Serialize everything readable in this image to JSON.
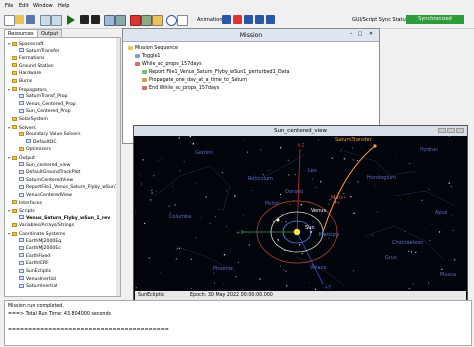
{
  "menu": {
    "file": "File",
    "edit": "Edit",
    "window": "Window",
    "help": "Help"
  },
  "toolbar": {
    "animation_label": "Animation",
    "sync_label": "GUI/Script Sync Status:",
    "sync_status": "Synchronized",
    "sync_color": "#2e9c3a"
  },
  "tabs": {
    "resources": "Resources",
    "output": "Output"
  },
  "resources": [
    {
      "label": "Spacecraft",
      "indent": 0,
      "icon": "folder",
      "expand": "−"
    },
    {
      "label": "SaturnTransfer",
      "indent": 1,
      "icon": "doc"
    },
    {
      "label": "Formations",
      "indent": 0,
      "icon": "folder"
    },
    {
      "label": "Ground Station",
      "indent": 0,
      "icon": "folder"
    },
    {
      "label": "Hardware",
      "indent": 0,
      "icon": "folder"
    },
    {
      "label": "Burns",
      "indent": 0,
      "icon": "folder"
    },
    {
      "label": "Propagators",
      "indent": 0,
      "icon": "folder",
      "expand": "−"
    },
    {
      "label": "SaturnTransf_Prop",
      "indent": 1,
      "icon": "doc"
    },
    {
      "label": "Venus_Centered_Prop",
      "indent": 1,
      "icon": "doc"
    },
    {
      "label": "Sun_Centered_Prop",
      "indent": 1,
      "icon": "doc"
    },
    {
      "label": "SolarSystem",
      "indent": 0,
      "icon": "folder"
    },
    {
      "label": "Solvers",
      "indent": 0,
      "icon": "folder",
      "expand": "−"
    },
    {
      "label": "Boundary Value Solvers",
      "indent": 1,
      "icon": "folder"
    },
    {
      "label": "DefaultDC",
      "indent": 2,
      "icon": "doc"
    },
    {
      "label": "Optimizers",
      "indent": 1,
      "icon": "folder"
    },
    {
      "label": "Output",
      "indent": 0,
      "icon": "folder",
      "expand": "−"
    },
    {
      "label": "Sun_centered_view",
      "indent": 1,
      "icon": "doc"
    },
    {
      "label": "DefaultGroundTrackPlot",
      "indent": 1,
      "icon": "doc"
    },
    {
      "label": "SaturnCenteredView",
      "indent": 1,
      "icon": "doc"
    },
    {
      "label": "ReportFile1_Venus_Saturn_Flyby_wSun1_pert",
      "indent": 1,
      "icon": "doc"
    },
    {
      "label": "VenusCenteredView",
      "indent": 1,
      "icon": "doc"
    },
    {
      "label": "Interfaces",
      "indent": 0,
      "icon": "folder"
    },
    {
      "label": "Scripts",
      "indent": 0,
      "icon": "folder",
      "expand": "−"
    },
    {
      "label": "Venus_Saturn_Flyby_wSun_1_rev",
      "indent": 1,
      "icon": "doc",
      "bold": true
    },
    {
      "label": "Variables/Arrays/Strings",
      "indent": 0,
      "icon": "folder"
    },
    {
      "label": "Coordinate Systems",
      "indent": 0,
      "icon": "folder",
      "expand": "−"
    },
    {
      "label": "EarthMJ2000Eq",
      "indent": 1,
      "icon": "doc"
    },
    {
      "label": "EarthMJ2000Ec",
      "indent": 1,
      "icon": "doc"
    },
    {
      "label": "EarthFixed",
      "indent": 1,
      "icon": "doc"
    },
    {
      "label": "EarthICRF",
      "indent": 1,
      "icon": "doc"
    },
    {
      "label": "SunEcliptic",
      "indent": 1,
      "icon": "doc"
    },
    {
      "label": "VenusInertial",
      "indent": 1,
      "icon": "doc"
    },
    {
      "label": "SaturnInertial",
      "indent": 1,
      "icon": "doc"
    }
  ],
  "mission": {
    "title": "Mission",
    "rows": [
      {
        "label": "Mission Sequence",
        "indent": 0,
        "color": "#e8c35a"
      },
      {
        "label": "Toggle1",
        "indent": 1,
        "color": "#7a9fd6"
      },
      {
        "label": "While_sc_props_157days",
        "indent": 1,
        "color": "#d66a6a"
      },
      {
        "label": "Report File1_Venus_Saturn_Flyby_wSun1_perturbed1_Data",
        "indent": 2,
        "color": "#7ab87a"
      },
      {
        "label": "Propagate_one_day_at_a_time_to_Saturn",
        "indent": 2,
        "color": "#d6a14a"
      },
      {
        "label": "End While_sc_props_157days",
        "indent": 2,
        "color": "#d66a6a"
      }
    ]
  },
  "view": {
    "title": "Sun_centered_view",
    "labels": [
      {
        "text": "Gemini",
        "color": "#5a6fc8"
      },
      {
        "text": "Leo",
        "color": "#5a6fc8"
      },
      {
        "text": "Columba",
        "color": "#5a6fc8"
      },
      {
        "text": "Dorado",
        "color": "#5a6fc8"
      },
      {
        "text": "Pictor",
        "color": "#5a6fc8"
      },
      {
        "text": "Volans",
        "color": "#5a6fc8"
      },
      {
        "text": "Phoenix",
        "color": "#5a6fc8"
      },
      {
        "text": "Grus",
        "color": "#5a6fc8"
      },
      {
        "text": "Chamaeleon",
        "color": "#5a6fc8"
      },
      {
        "text": "Apus",
        "color": "#5a6fc8"
      },
      {
        "text": "Musca",
        "color": "#5a6fc8"
      },
      {
        "text": "Hydrus",
        "color": "#5a6fc8"
      },
      {
        "text": "Reticulum",
        "color": "#5a6fc8"
      },
      {
        "text": "Horologium",
        "color": "#5a6fc8"
      }
    ],
    "bodies": {
      "venus": "Venus",
      "sun": "Sun",
      "mercury": "Mercury",
      "mars": "Mars",
      "spacecraft": "SaturnTransfer"
    },
    "axis_labels": {
      "x": "+X",
      "y": "+Y",
      "z": "+Z"
    },
    "footer_frame": "SunEcliptic",
    "footer_epoch": "Epoch: 30 May 2022 00:00:00.000"
  },
  "messages": [
    "Mission run completed.",
    "===> Total Run Time: 43.804000 seconds",
    "",
    "========================================"
  ]
}
